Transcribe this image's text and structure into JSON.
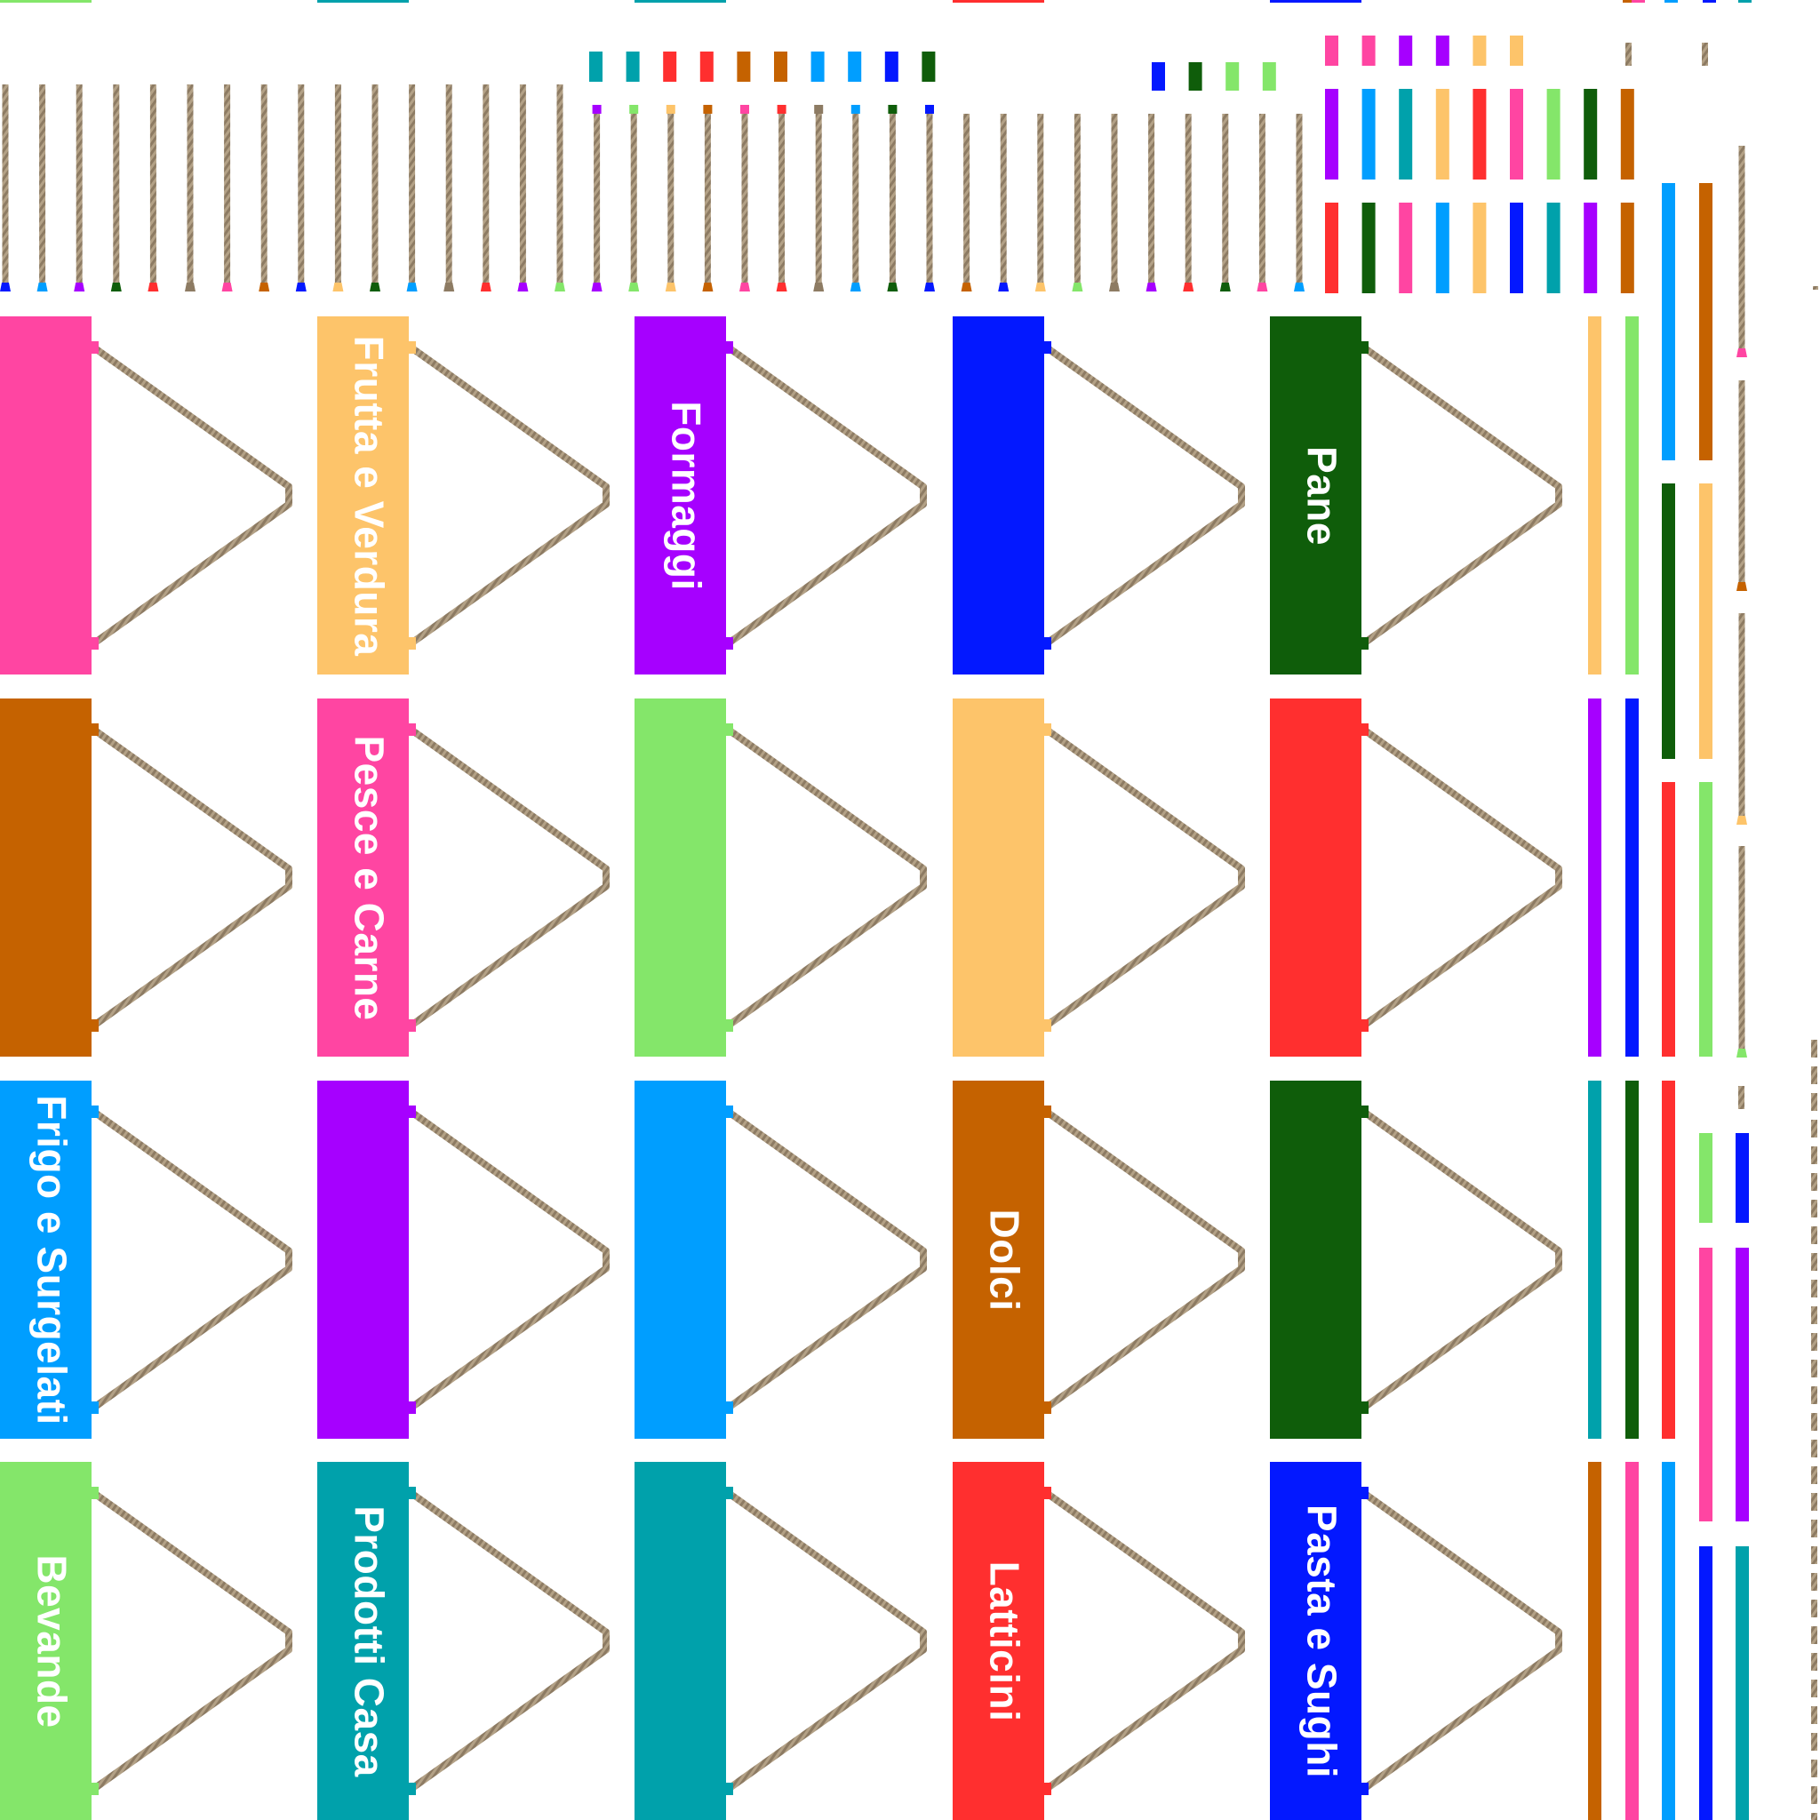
{
  "palette": {
    "pink": "#ff45a2",
    "peach": "#fdc46a",
    "purple": "#a600ff",
    "blue": "#0318ff",
    "darkgreen": "#0f5d0a",
    "brown": "#c56200",
    "lightgreen": "#84e66a",
    "red": "#ff2f2f",
    "skyblue": "#009eff",
    "teal": "#00a1ab",
    "rope": "#8d7b63"
  },
  "signs": [
    {
      "label": "",
      "color": "pink"
    },
    {
      "label": "Frutta e Verdura",
      "color": "peach"
    },
    {
      "label": "Formaggi",
      "color": "purple"
    },
    {
      "label": "",
      "color": "blue"
    },
    {
      "label": "Pane",
      "color": "darkgreen"
    },
    {
      "label": "",
      "color": "brown"
    },
    {
      "label": "Pesce e Carne",
      "color": "pink"
    },
    {
      "label": "",
      "color": "lightgreen"
    },
    {
      "label": "",
      "color": "peach"
    },
    {
      "label": "",
      "color": "red"
    },
    {
      "label": "Frigo e Surgelati",
      "color": "skyblue"
    },
    {
      "label": "",
      "color": "purple"
    },
    {
      "label": "",
      "color": "skyblue"
    },
    {
      "label": "Dolci",
      "color": "brown"
    },
    {
      "label": "",
      "color": "darkgreen"
    },
    {
      "label": "Bevande",
      "color": "lightgreen"
    },
    {
      "label": "Prodotti Casa",
      "color": "teal"
    },
    {
      "label": "",
      "color": "teal"
    },
    {
      "label": "Latticini",
      "color": "red"
    },
    {
      "label": "Pasta e Sughi",
      "color": "blue"
    }
  ],
  "hanging_cords": {
    "bead_colors": [
      "blue",
      "skyblue",
      "purple",
      "darkgreen",
      "red",
      "rope",
      "pink",
      "brown",
      "blue",
      "peach",
      "darkgreen",
      "skyblue",
      "rope",
      "red",
      "purple",
      "lightgreen",
      "purple",
      "lightgreen",
      "peach",
      "brown",
      "pink",
      "red",
      "rope",
      "skyblue",
      "darkgreen",
      "blue",
      "brown",
      "blue",
      "peach",
      "lightgreen",
      "rope",
      "purple",
      "red",
      "darkgreen",
      "pink",
      "skyblue"
    ],
    "top_tab_colors": [
      "purple",
      "lightgreen",
      "peach",
      "brown",
      "pink",
      "red",
      "rope",
      "skyblue",
      "darkgreen",
      "blue"
    ]
  },
  "swatches": {
    "row1": [
      "teal",
      "teal",
      "red",
      "red",
      "brown",
      "brown",
      "skyblue",
      "skyblue",
      "blue",
      "darkgreen"
    ],
    "row2": [
      "blue",
      "darkgreen",
      "lightgreen",
      "lightgreen"
    ],
    "row3": [
      "pink",
      "pink",
      "purple",
      "purple",
      "peach",
      "peach"
    ]
  },
  "strips": {
    "top_upper": [
      "purple",
      "skyblue",
      "teal",
      "peach",
      "red",
      "pink",
      "lightgreen",
      "darkgreen",
      "brown"
    ],
    "top_lower": [
      "red",
      "darkgreen",
      "pink",
      "skyblue",
      "peach",
      "blue",
      "teal",
      "purple",
      "brown"
    ],
    "right_col_a": [
      "peach",
      "purple",
      "teal",
      "brown"
    ],
    "right_col_b": [
      "lightgreen",
      "blue",
      "darkgreen",
      "pink"
    ],
    "right_col_c": [
      "red",
      "red",
      "skyblue"
    ],
    "tall_a": [
      "skyblue",
      "darkgreen"
    ],
    "tall_b": [
      "brown",
      "peach",
      "lightgreen"
    ],
    "lower_right_a": [
      "lightgreen",
      "pink",
      "blue"
    ],
    "lower_right_b": [
      "blue",
      "purple",
      "teal"
    ]
  },
  "right_cord_beads": [
    "pink",
    "brown",
    "peach",
    "lightgreen"
  ]
}
